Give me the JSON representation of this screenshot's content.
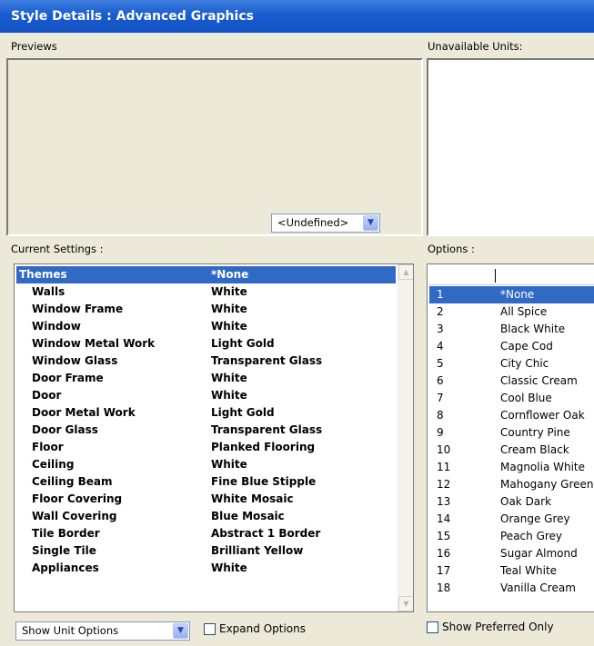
{
  "window": {
    "title": "Style Details : Advanced Graphics"
  },
  "previews": {
    "label": "Previews",
    "dropdown_value": "<Undefined>"
  },
  "unavailable_units": {
    "label": "Unavailable Units:"
  },
  "current_settings": {
    "label": "Current Settings :",
    "rows": [
      {
        "name": "Themes",
        "value": "*None",
        "selected": true
      },
      {
        "name": "Walls",
        "value": "White"
      },
      {
        "name": "Window Frame",
        "value": "White"
      },
      {
        "name": "Window",
        "value": "White"
      },
      {
        "name": "Window Metal Work",
        "value": "Light Gold"
      },
      {
        "name": "Window Glass",
        "value": "Transparent Glass"
      },
      {
        "name": "Door Frame",
        "value": "White"
      },
      {
        "name": "Door",
        "value": "White"
      },
      {
        "name": "Door Metal Work",
        "value": "Light Gold"
      },
      {
        "name": "Door Glass",
        "value": "Transparent Glass"
      },
      {
        "name": "Floor",
        "value": "Planked Flooring"
      },
      {
        "name": "Ceiling",
        "value": "White"
      },
      {
        "name": "Ceiling Beam",
        "value": "Fine Blue Stipple"
      },
      {
        "name": "Floor Covering",
        "value": "White Mosaic"
      },
      {
        "name": "Wall Covering",
        "value": "Blue Mosaic"
      },
      {
        "name": "Tile Border",
        "value": "Abstract 1 Border"
      },
      {
        "name": "Single Tile",
        "value": "Brilliant Yellow"
      },
      {
        "name": "Appliances",
        "value": "White"
      }
    ]
  },
  "options": {
    "label": "Options :",
    "rows": [
      {
        "num": "1",
        "name": "*None",
        "selected": true
      },
      {
        "num": "2",
        "name": "All Spice"
      },
      {
        "num": "3",
        "name": "Black White"
      },
      {
        "num": "4",
        "name": "Cape Cod"
      },
      {
        "num": "5",
        "name": "City Chic"
      },
      {
        "num": "6",
        "name": "Classic Cream"
      },
      {
        "num": "7",
        "name": "Cool Blue"
      },
      {
        "num": "8",
        "name": "Cornflower Oak"
      },
      {
        "num": "9",
        "name": "Country Pine"
      },
      {
        "num": "10",
        "name": "Cream Black"
      },
      {
        "num": "11",
        "name": "Magnolia White"
      },
      {
        "num": "12",
        "name": "Mahogany Green"
      },
      {
        "num": "13",
        "name": "Oak Dark"
      },
      {
        "num": "14",
        "name": "Orange Grey"
      },
      {
        "num": "15",
        "name": "Peach Grey"
      },
      {
        "num": "16",
        "name": "Sugar Almond"
      },
      {
        "num": "17",
        "name": "Teal White"
      },
      {
        "num": "18",
        "name": "Vanilla Cream"
      }
    ]
  },
  "bottom": {
    "show_dropdown_value": "Show Unit Options",
    "expand_options_label": "Expand Options",
    "show_preferred_label": "Show Preferred Only"
  },
  "colors": {
    "title_bar": "#1a5ccd",
    "selection": "#316ac5",
    "background": "#ece9d8"
  }
}
